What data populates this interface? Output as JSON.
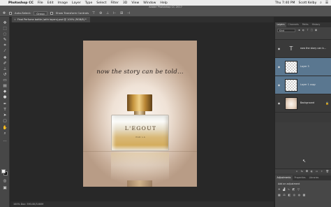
{
  "menubar": {
    "apple": "",
    "app": "Photoshop CC",
    "items": [
      "File",
      "Edit",
      "Image",
      "Layer",
      "Type",
      "Select",
      "Filter",
      "3D",
      "View",
      "Window",
      "Help"
    ],
    "clock": "Thu 7:40 PM",
    "user": "Scott Kelby"
  },
  "optionsbar": {
    "window_title": "Adobe Photoshop CC 2017",
    "auto_select_label": "Auto-Select:",
    "auto_select_value": "Group",
    "transform_label": "Show Transform Controls"
  },
  "document": {
    "tab_label": "Final Perfume bottle (with layers).psd @ 100% (RGB/8) *",
    "tagline": "now the story can be told...",
    "brand": "L'EGOUT",
    "sub_label": "PAR LA"
  },
  "status": {
    "text": "100%   Doc: 593.0K/3.60M"
  },
  "panels": {
    "tabs": [
      "Layers",
      "Channels",
      "Paths",
      "History"
    ],
    "kind_label": "Kind",
    "layers": [
      {
        "name": "now the story can b...",
        "type": "text",
        "selected": false
      },
      {
        "name": "Layer 3",
        "type": "pixel",
        "selected": true
      },
      {
        "name": "Layer 1 copy",
        "type": "pixel",
        "selected": true
      },
      {
        "name": "Background",
        "type": "background",
        "selected": false
      }
    ],
    "adj_tabs": [
      "Adjustments",
      "Properties",
      "Libraries"
    ],
    "adj_label": "Add an adjustment"
  }
}
